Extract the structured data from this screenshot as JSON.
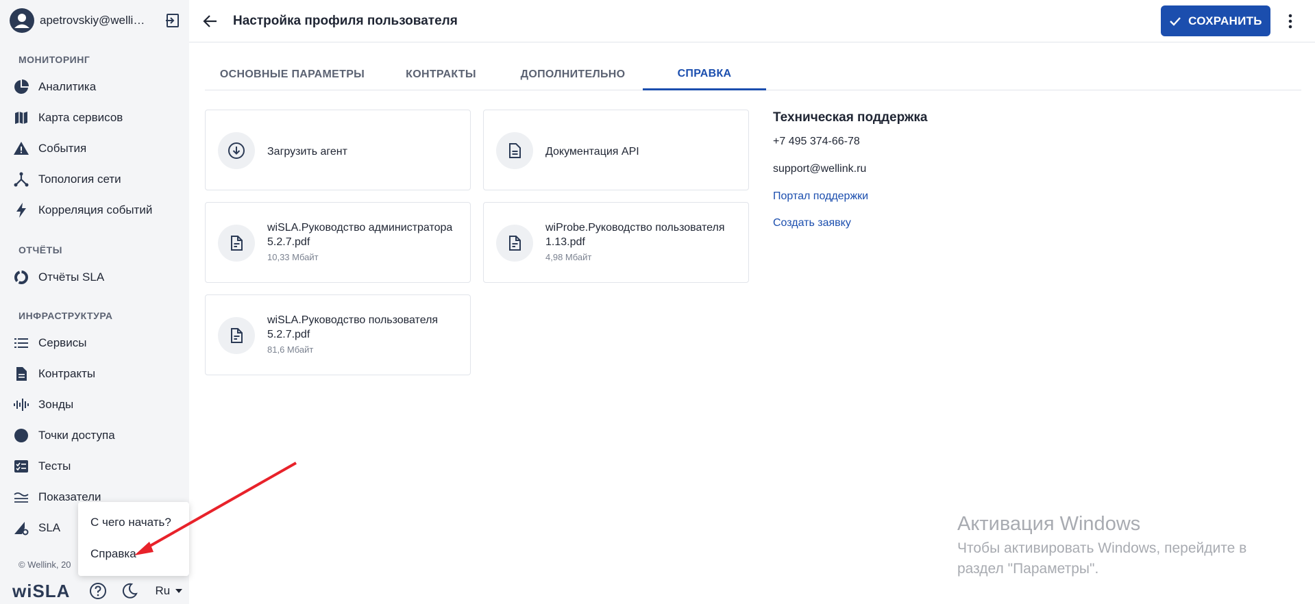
{
  "user": {
    "email": "apetrovskiy@wellink.ru"
  },
  "sidebar": {
    "sections": {
      "monitoring": "МОНИТОРИНГ",
      "reports": "ОТЧЁТЫ",
      "infrastructure": "ИНФРАСТРУКТУРА"
    },
    "items": {
      "analytics": "Аналитика",
      "service_map": "Карта сервисов",
      "events": "События",
      "topology": "Топология сети",
      "correlation": "Корреляция событий",
      "sla_reports": "Отчёты SLA",
      "services": "Сервисы",
      "contracts": "Контракты",
      "probes": "Зонды",
      "access_points": "Точки доступа",
      "tests": "Тесты",
      "metrics": "Показатели",
      "sla": "SLA"
    },
    "copyright": "© Wellink, 20",
    "logo": "wiSLA",
    "language": "Ru"
  },
  "popup": {
    "getting_started": "С чего начать?",
    "help": "Справка"
  },
  "header": {
    "title": "Настройка профиля пользователя",
    "save_label": "СОХРАНИТЬ"
  },
  "tabs": {
    "basic": "ОСНОВНЫЕ ПАРАМЕТРЫ",
    "contracts": "КОНТРАКТЫ",
    "additional": "ДОПОЛНИТЕЛЬНО",
    "help": "СПРАВКА"
  },
  "cards": {
    "download_agent": "Загрузить агент",
    "api_docs": "Документация API",
    "admin_guide": {
      "title": "wiSLA.Руководство администратора 5.2.7.pdf",
      "size": "10,33 Мбайт"
    },
    "probe_guide": {
      "title": "wiProbe.Руководство пользователя 1.13.pdf",
      "size": "4,98 Мбайт"
    },
    "user_guide": {
      "title": "wiSLA.Руководство пользователя 5.2.7.pdf",
      "size": "81,6 Мбайт"
    }
  },
  "support": {
    "title": "Техническая поддержка",
    "phone": "+7 495 374-66-78",
    "email": "support@wellink.ru",
    "portal_link": "Портал поддержки",
    "ticket_link": "Создать заявку"
  },
  "watermark": {
    "title": "Активация Windows",
    "line1": "Чтобы активировать Windows, перейдите в",
    "line2": "раздел \"Параметры\"."
  },
  "colors": {
    "accent": "#1b4eae",
    "sidebar_bg": "#f4f5f7",
    "annotation_arrow": "#e8222a"
  }
}
